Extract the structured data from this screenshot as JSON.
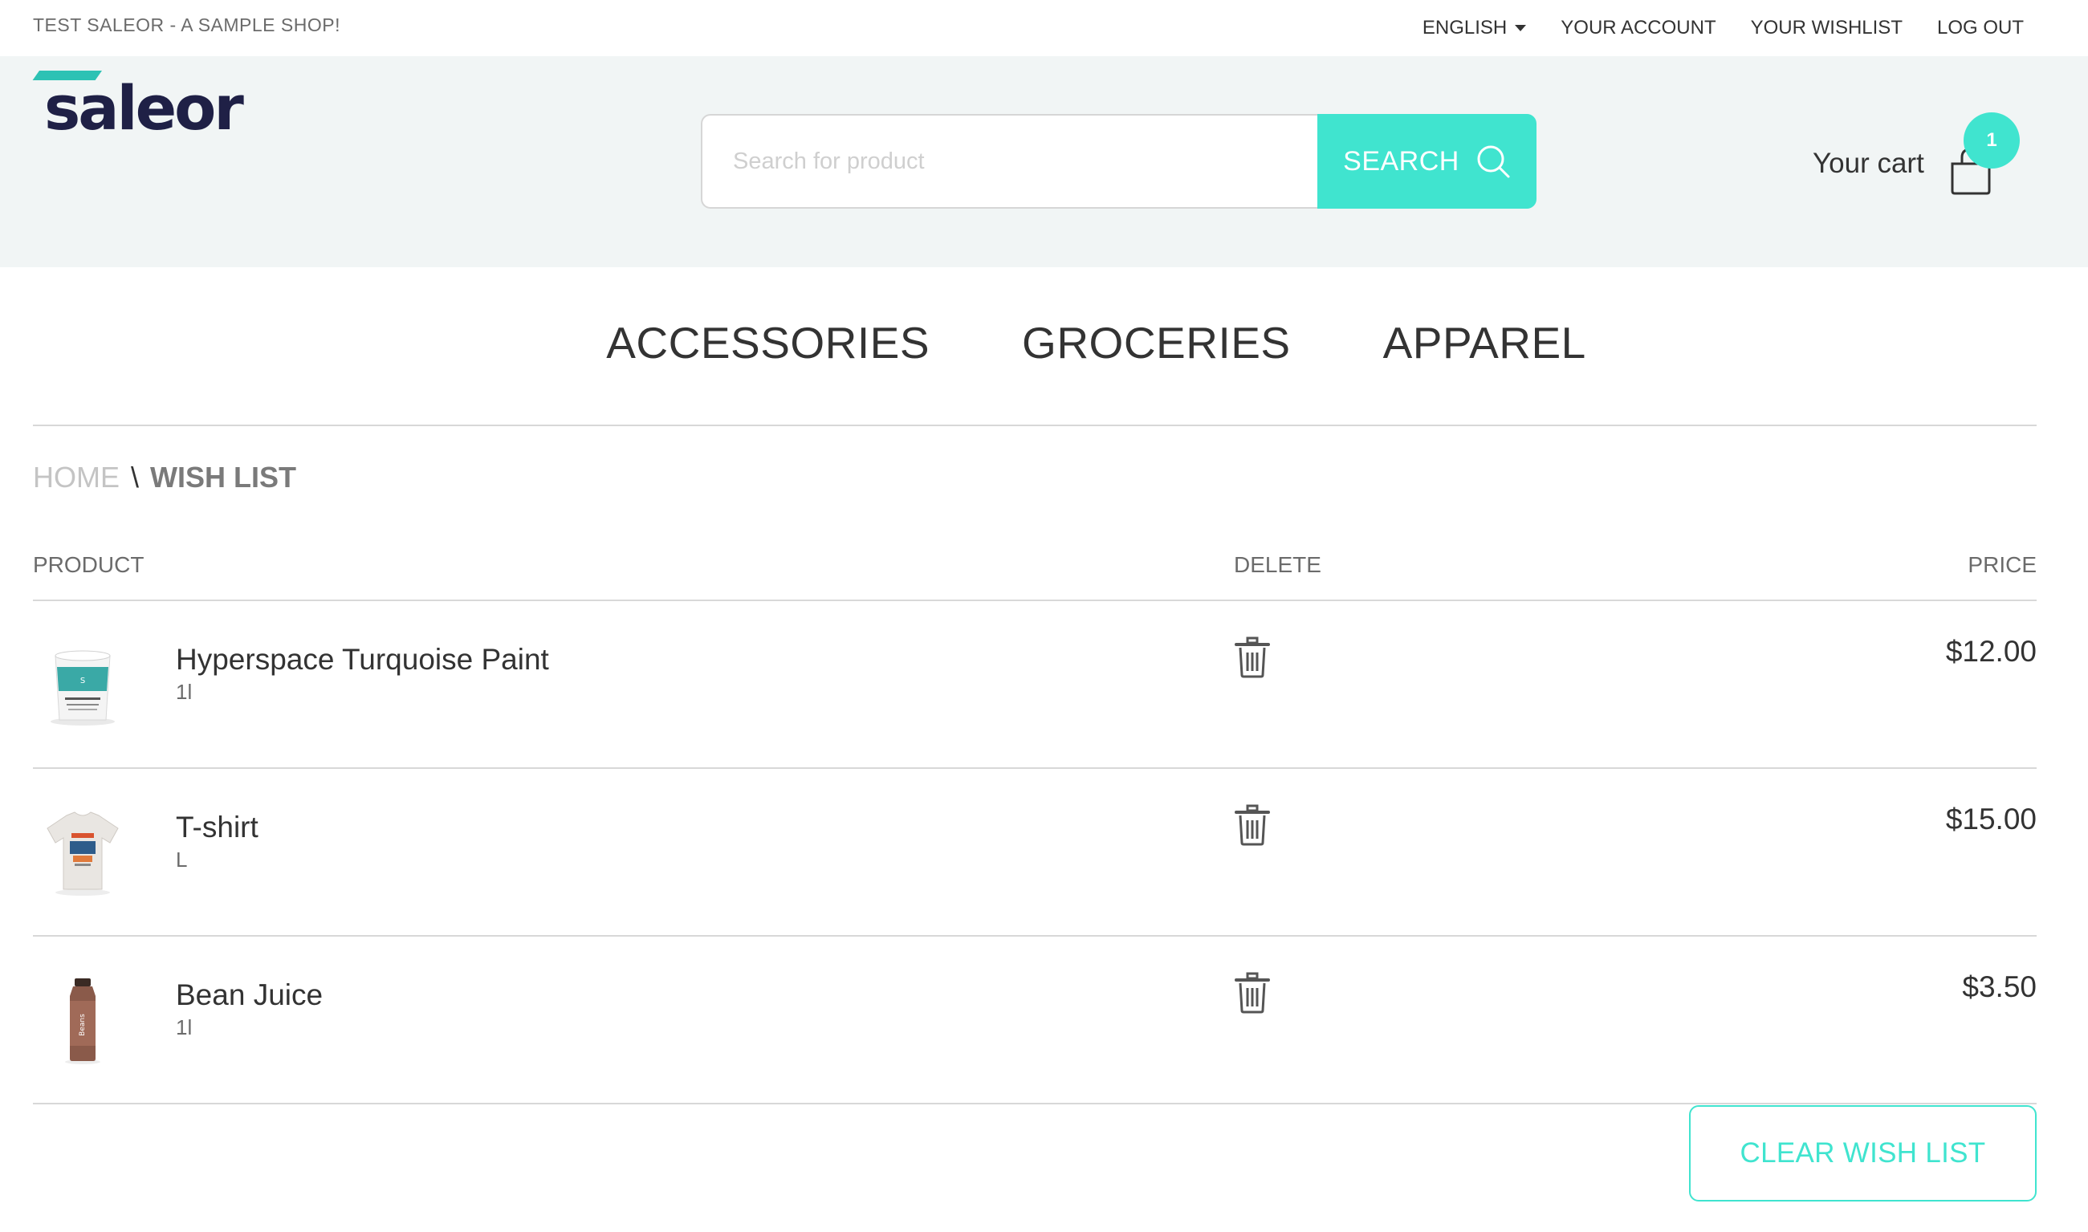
{
  "topbar": {
    "shop_name": "TEST SALEOR - A SAMPLE SHOP!",
    "language": "ENGLISH",
    "account": "YOUR ACCOUNT",
    "wishlist": "YOUR WISHLIST",
    "logout": "LOG OUT"
  },
  "header": {
    "logo_text": "saleor",
    "search_placeholder": "Search for product",
    "search_button": "SEARCH",
    "cart_label": "Your cart",
    "cart_count": "1"
  },
  "nav": {
    "items": [
      "ACCESSORIES",
      "GROCERIES",
      "APPAREL"
    ]
  },
  "breadcrumb": {
    "home": "HOME",
    "separator": "\\",
    "current": "WISH LIST"
  },
  "table": {
    "headers": {
      "product": "PRODUCT",
      "delete": "DELETE",
      "price": "PRICE"
    },
    "rows": [
      {
        "name": "Hyperspace Turquoise Paint",
        "variant": "1l",
        "price": "$12.00",
        "icon": "paint-bucket-thumbnail"
      },
      {
        "name": "T-shirt",
        "variant": "L",
        "price": "$15.00",
        "icon": "tshirt-thumbnail"
      },
      {
        "name": "Bean Juice",
        "variant": "1l",
        "price": "$3.50",
        "icon": "juice-bottle-thumbnail"
      }
    ]
  },
  "actions": {
    "clear_wishlist": "CLEAR WISH LIST"
  },
  "colors": {
    "accent": "#40e4cf",
    "logo_dark": "#1f2046",
    "header_bg": "#f1f5f5"
  }
}
